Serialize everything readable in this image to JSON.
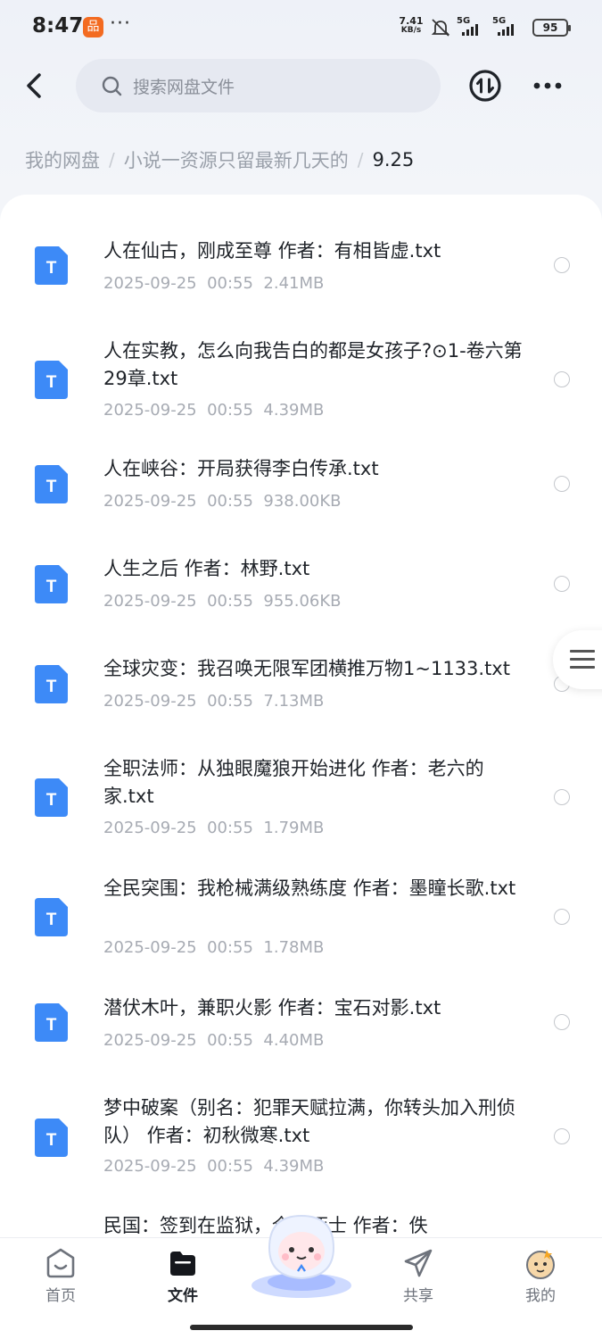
{
  "status_bar": {
    "time": "8:47",
    "app_badge": "品",
    "more": "···",
    "net_speed_value": "7.41",
    "net_speed_unit": "KB/s",
    "signal1_label": "5G",
    "signal2_label": "5G",
    "battery": "95"
  },
  "header": {
    "search_placeholder": "搜索网盘文件"
  },
  "breadcrumb": {
    "items": [
      "我的网盘",
      "小说一资源只留最新几天的"
    ],
    "separator": "/",
    "current": "9.25"
  },
  "files": [
    {
      "name": "人在仙古，刚成至尊 作者：有相皆虚.txt",
      "date": "2025-09-25",
      "time": "00:55",
      "size": "2.41MB"
    },
    {
      "name": "人在实教，怎么向我告白的都是女孩子?⊙1-卷六第29章.txt",
      "date": "2025-09-25",
      "time": "00:55",
      "size": "4.39MB"
    },
    {
      "name": "人在峡谷：开局获得李白传承.txt",
      "date": "2025-09-25",
      "time": "00:55",
      "size": "938.00KB"
    },
    {
      "name": "人生之后 作者：林野.txt",
      "date": "2025-09-25",
      "time": "00:55",
      "size": "955.06KB"
    },
    {
      "name": "全球灾变：我召唤无限军团横推万物1~1133.txt",
      "date": "2025-09-25",
      "time": "00:55",
      "size": "7.13MB"
    },
    {
      "name": "全职法师：从独眼魔狼开始进化 作者：老六的家.txt",
      "date": "2025-09-25",
      "time": "00:55",
      "size": "1.79MB"
    },
    {
      "name": "全民突围：我枪械满级熟练度 作者：墨瞳长歌.txt",
      "date": "2025-09-25",
      "time": "00:55",
      "size": "1.78MB"
    },
    {
      "name": "潜伏木叶，兼职火影 作者：宝石对影.txt",
      "date": "2025-09-25",
      "time": "00:55",
      "size": "4.40MB"
    },
    {
      "name": "梦中破案（别名：犯罪天赋拉满，你转头加入刑侦队） 作者：初秋微寒.txt",
      "date": "2025-09-25",
      "time": "00:55",
      "size": "4.39MB"
    },
    {
      "name": "民国：签到在监狱，全是死士 作者：佚",
      "date": "",
      "time": "",
      "size": ""
    }
  ],
  "file_icon_letter": "T",
  "bottom_nav": [
    {
      "label": "首页",
      "icon": "home-smile-icon",
      "active": false
    },
    {
      "label": "文件",
      "icon": "folder-icon",
      "active": true
    },
    {
      "label": "共享",
      "icon": "send-icon",
      "active": false
    },
    {
      "label": "我的",
      "icon": "profile-avatar-icon",
      "active": false
    }
  ],
  "colors": {
    "file_icon_blue": "#3d8af7",
    "text_primary": "#1f2329",
    "text_secondary": "#a7abb3"
  }
}
